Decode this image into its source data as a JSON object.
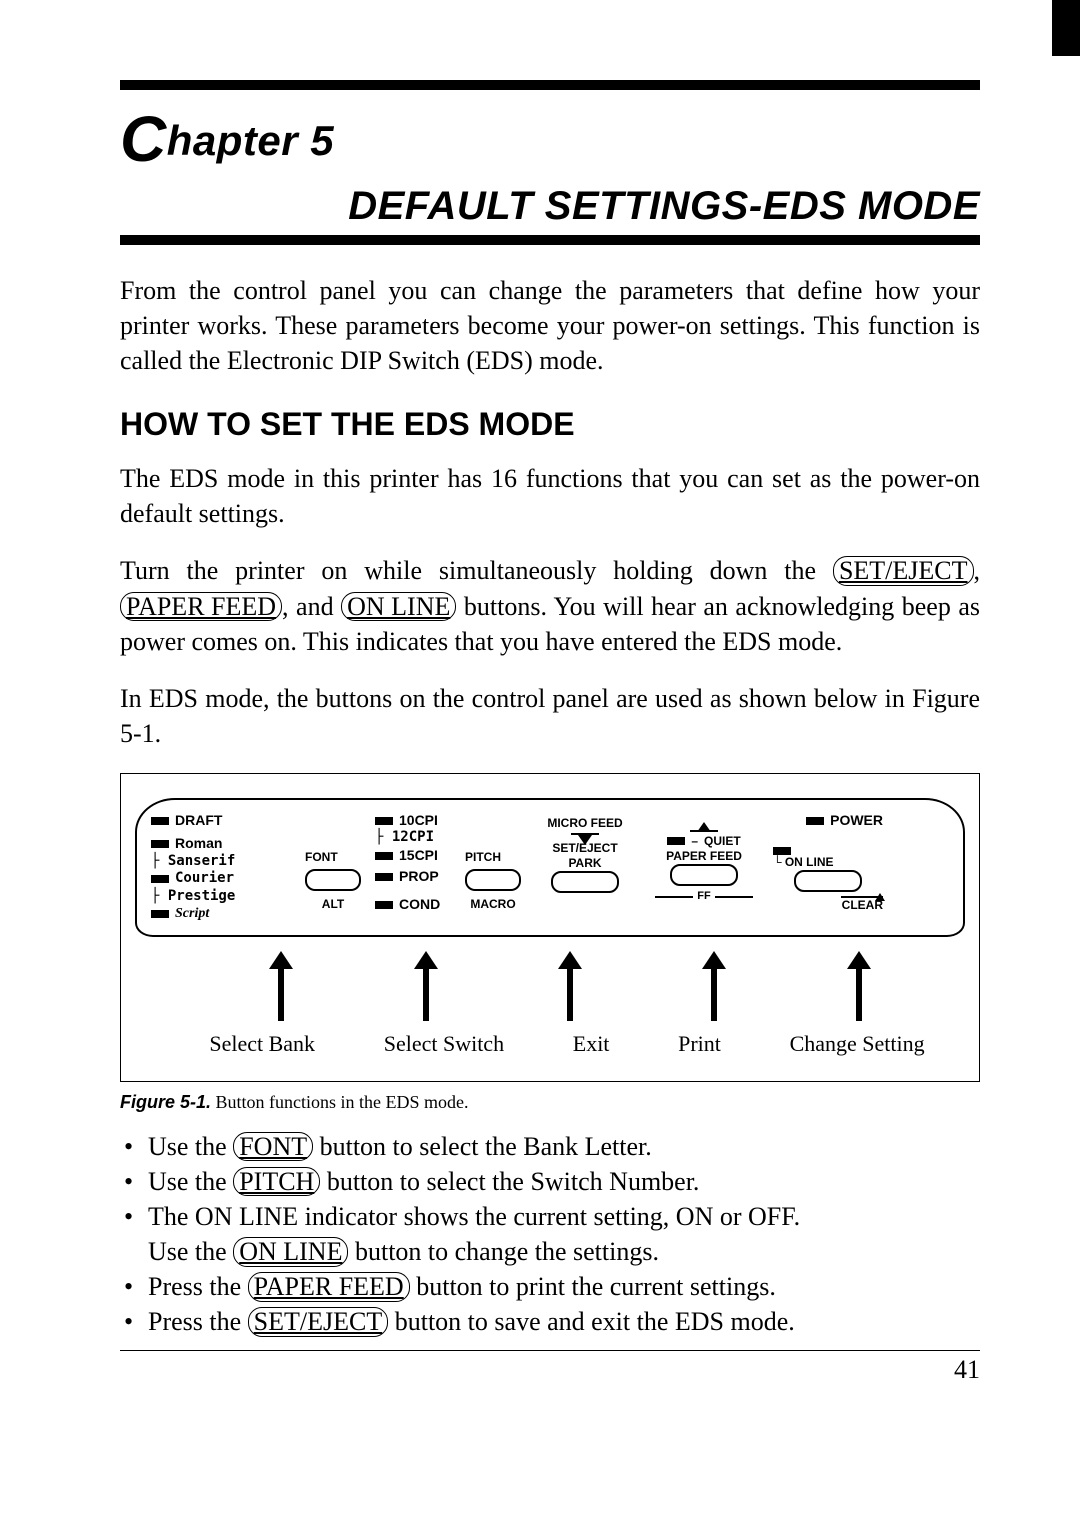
{
  "chapter": {
    "prefix": "C",
    "rest": "hapter 5",
    "title": "DEFAULT SETTINGS-EDS MODE"
  },
  "intro": "From the control panel you can change the parameters that define how your printer works. These parameters become your power-on settings. This function is called the Electronic DIP Switch (EDS) mode.",
  "section_heading": "HOW TO SET THE EDS MODE",
  "para1": "The EDS mode in this printer has 16 functions that you can set as the power-on default settings.",
  "para2_a": "Turn the printer on while simultaneously holding down the ",
  "para2_btn1": "SET/EJECT",
  "para2_b": ", ",
  "para2_btn2": "PAPER FEED",
  "para2_c": ", and ",
  "para2_btn3": "ON LINE",
  "para2_d": " buttons. You will hear an acknowledging beep as power comes on. This indicates that you have entered the EDS mode.",
  "para3": "In EDS mode, the buttons on the control panel are used as shown below in Figure 5-1.",
  "panel": {
    "fonts": {
      "draft": "DRAFT",
      "roman": "Roman",
      "sanserif": "Sanserif",
      "courier": "Courier",
      "prestige": "Prestige",
      "script": "Script",
      "label": "FONT",
      "alt": "ALT"
    },
    "pitch": {
      "p10": "10CPI",
      "p12": "12CPI",
      "p15": "15CPI",
      "prop": "PROP",
      "cond": "COND",
      "label": "PITCH",
      "macro": "MACRO"
    },
    "microfeed": "MICRO FEED",
    "seteject": "SET/EJECT",
    "park": "PARK",
    "quiet": "QUIET",
    "paperfeed": "PAPER FEED",
    "ff": "FF",
    "power": "POWER",
    "online": "ON LINE",
    "clear": "CLEAR"
  },
  "arrows": {
    "a1": "Select Bank",
    "a2": "Select Switch",
    "a3": "Exit",
    "a4": "Print",
    "a5": "Change Setting"
  },
  "figcap_label": "Figure 5-1.",
  "figcap_text": " Button functions in the EDS mode.",
  "bullets": {
    "b1a": "Use the ",
    "b1btn": "FONT",
    "b1b": " button to select the Bank Letter.",
    "b2a": "Use the ",
    "b2btn": "PITCH",
    "b2b": " button to select the Switch Number.",
    "b3a": "The ON LINE  indicator shows the current setting, ON or OFF.",
    "b3b_a": "Use the ",
    "b3b_btn": "ON LINE",
    "b3b_b": " button to change the settings.",
    "b4a": "Press the ",
    "b4btn": "PAPER FEED",
    "b4b": " button to print the current settings.",
    "b5a": "Press the ",
    "b5btn": "SET/EJECT",
    "b5b": " button to save and exit the EDS mode."
  },
  "pagenum": "41"
}
